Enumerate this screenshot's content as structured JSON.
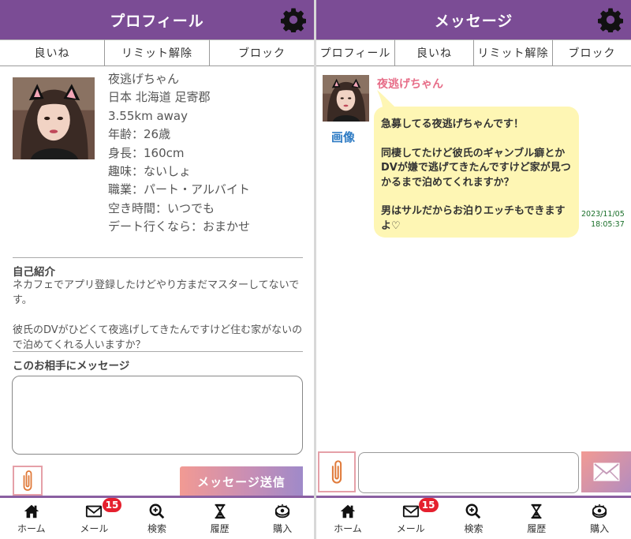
{
  "left": {
    "header": {
      "title": "プロフィール"
    },
    "tabs": [
      "良いね",
      "リミット解除",
      "ブロック"
    ],
    "profile": {
      "lines": [
        "夜逃げちゃん",
        "日本 北海道 足寄郡",
        "3.55km away",
        "年齢：26歳",
        "身長：160cm",
        "趣味：ないしょ",
        "職業：パート・アルバイト",
        "空き時間：いつでも",
        "デート行くなら：おまかせ"
      ]
    },
    "intro": {
      "label": "自己紹介",
      "text": "ネカフェでアプリ登録したけどやり方まだマスターしてないです。\n\n彼氏のDVがひどくて夜逃げしてきたんですけど住む家がないので泊めてくれる人いますか？"
    },
    "message_form": {
      "label": "このお相手にメッセージ",
      "value": "",
      "send_label": "メッセージ送信"
    }
  },
  "right": {
    "header": {
      "title": "メッセージ"
    },
    "tabs": [
      "プロフィール",
      "良いね",
      "リミット解除",
      "ブロック"
    ],
    "sender": "夜逃げちゃん",
    "image_link": "画像",
    "message": {
      "text": "急募してる夜逃げちゃんです！\n\n同棲してたけど彼氏のギャンブル癖とかDVが嫌で逃げてきたんですけど家が見つかるまで泊めてくれますか？\n\n男はサルだからお泊りエッチもできますよ♡",
      "date": "2023/11/05",
      "time": "18:05:37"
    },
    "input_value": ""
  },
  "nav": {
    "items": [
      {
        "label": "ホーム",
        "icon": "home-icon"
      },
      {
        "label": "メール",
        "icon": "mail-icon",
        "badge": "15"
      },
      {
        "label": "検索",
        "icon": "search-icon"
      },
      {
        "label": "履歴",
        "icon": "hourglass-icon"
      },
      {
        "label": "購入",
        "icon": "coin-icon"
      }
    ]
  },
  "colors": {
    "header": "#7b4c95",
    "accent_pink": "#e76d88",
    "link_blue": "#2f7cc4",
    "bubble": "#fef6b4",
    "badge": "#e5202e",
    "time_green": "#1a6f2a"
  }
}
